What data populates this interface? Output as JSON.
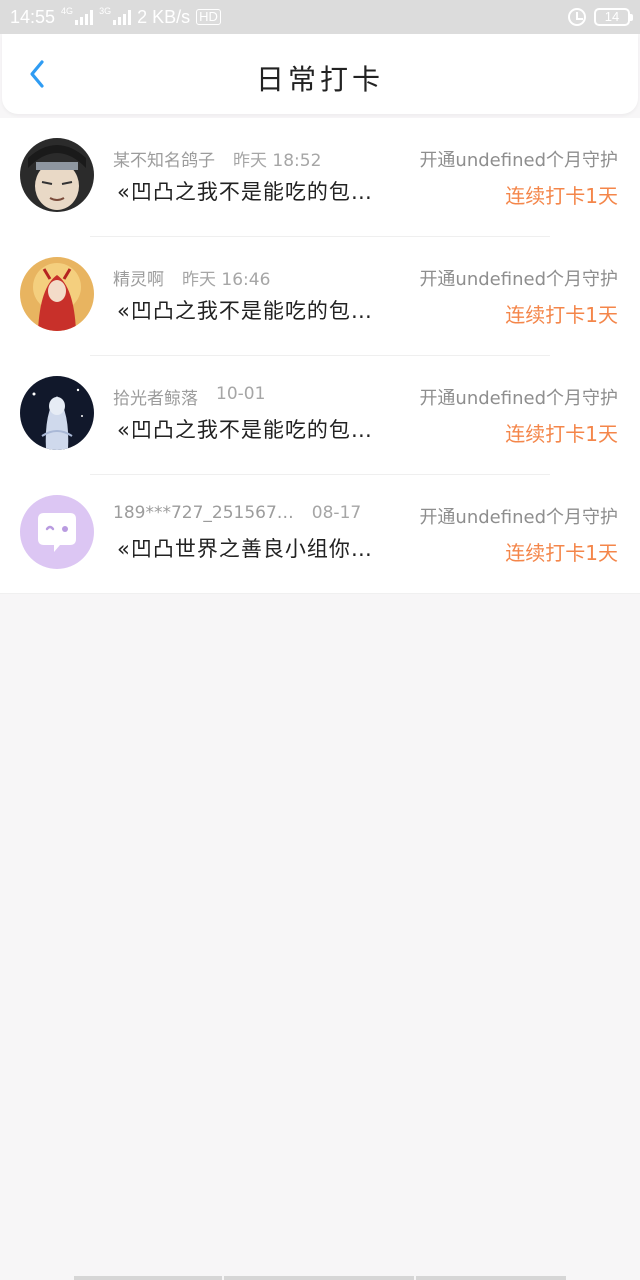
{
  "status_bar": {
    "time": "14:55",
    "net_label_1": "4G",
    "net_label_2": "3G",
    "speed": "2 KB/s",
    "hd": "HD",
    "battery": "14"
  },
  "header": {
    "title": "日常打卡",
    "back_icon": "chevron-left-icon",
    "accent": "#2f9cf3"
  },
  "items": [
    {
      "name": "某不知名鸽子",
      "time": "昨天 18:52",
      "book": "«凹凸之我不是能吃的包…",
      "guard": "开通undefined个月守护",
      "streak": "连续打卡1天",
      "avatar_icon": "anime-avatar"
    },
    {
      "name": "精灵啊",
      "time": "昨天 16:46",
      "book": "«凹凸之我不是能吃的包…",
      "guard": "开通undefined个月守护",
      "streak": "连续打卡1天",
      "avatar_icon": "anime-avatar"
    },
    {
      "name": "拾光者鲸落",
      "time": "10-01",
      "book": "«凹凸之我不是能吃的包…",
      "guard": "开通undefined个月守护",
      "streak": "连续打卡1天",
      "avatar_icon": "anime-avatar"
    },
    {
      "name": "189***727_251567…",
      "time": "08-17",
      "book": "«凹凸世界之善良小组你…",
      "guard": "开通undefined个月守护",
      "streak": "连续打卡1天",
      "avatar_icon": "chat-bubble-avatar"
    }
  ],
  "colors": {
    "streak": "#f4864a",
    "background": "#f7f6f7",
    "default_avatar": "#d9c3f2"
  }
}
